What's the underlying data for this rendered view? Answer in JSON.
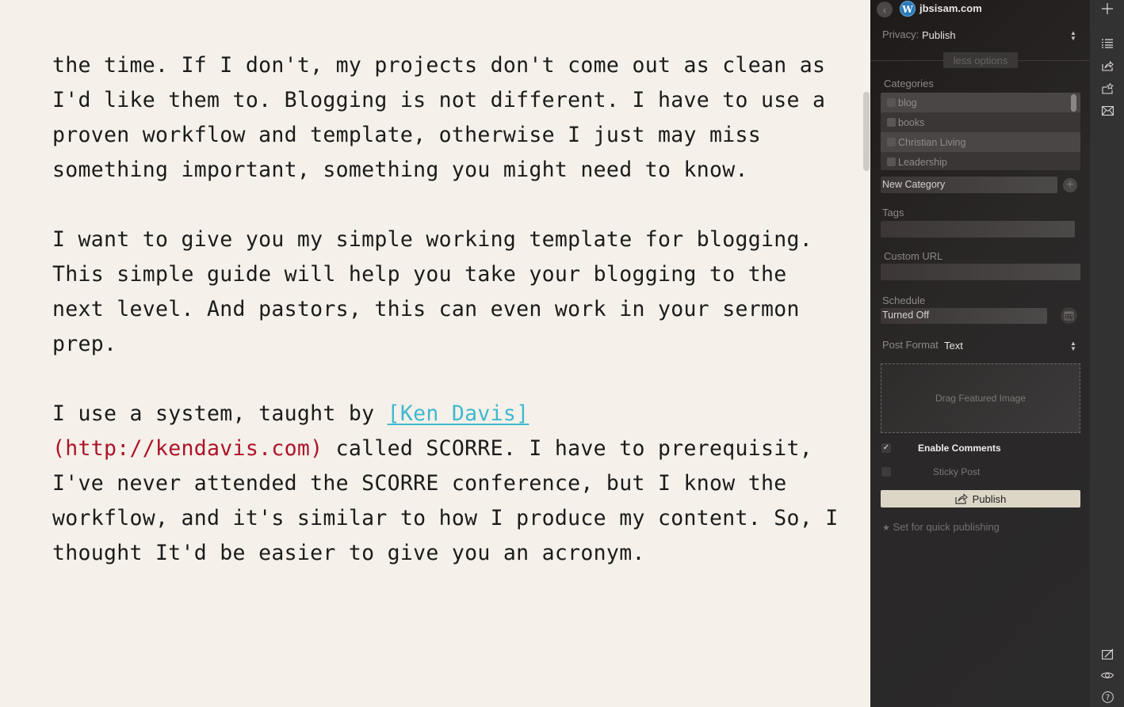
{
  "editor": {
    "paragraphs": [
      {
        "text": "the time. If I don't, my projects don't come out as clean as I'd like them to. Blogging is not different. I have to use a proven workflow and template, otherwise I just may miss something important, something you might need to know."
      },
      {
        "text": "I want to give you my simple working template for blogging. This simple guide will help you take your blogging to the next level. And pastors, this can even work in your sermon prep."
      },
      {
        "before_link": "I use a system, taught by ",
        "link_text": "[Ken Davis]",
        "link_url": "(http://kendavis.com)",
        "after_link": " called SCORRE. I have to prerequisit, I've never attended the SCORRE conference, but I know the workflow, and it's similar to how I produce my content. So, I thought It'd be easier to give you an acronym."
      }
    ],
    "colors": {
      "link": "#3fb9cf",
      "url": "#ad1329",
      "text": "#1b1b1b",
      "background": "#f5f1ea"
    }
  },
  "panel": {
    "site_name": "jbsisam.com",
    "privacy": {
      "label": "Privacy:",
      "value": "Publish"
    },
    "less_options_label": "less options",
    "categories": {
      "label": "Categories",
      "items": [
        {
          "name": "blog",
          "checked": false
        },
        {
          "name": "books",
          "checked": false
        },
        {
          "name": "Christian Living",
          "checked": false
        },
        {
          "name": "Leadership",
          "checked": false
        }
      ],
      "new_category_value": "New Category"
    },
    "tags": {
      "label": "Tags",
      "value": ""
    },
    "custom_url": {
      "label": "Custom URL",
      "value": ""
    },
    "schedule": {
      "label": "Schedule",
      "value": "Turned Off"
    },
    "post_format": {
      "label": "Post Format",
      "value": "Text"
    },
    "featured_image_label": "Drag Featured Image",
    "enable_comments": {
      "label": "Enable Comments",
      "checked": true
    },
    "sticky_post": {
      "label": "Sticky Post",
      "checked": false
    },
    "publish_label": "Publish",
    "quick_publish_label": "Set for quick publishing"
  },
  "toolbar": {
    "top_icons": [
      "plus-icon",
      "list-icon",
      "publish-icon",
      "favorite-icon",
      "mail-icon"
    ],
    "bottom_icons": [
      "edit-icon",
      "preview-icon",
      "help-icon"
    ]
  }
}
